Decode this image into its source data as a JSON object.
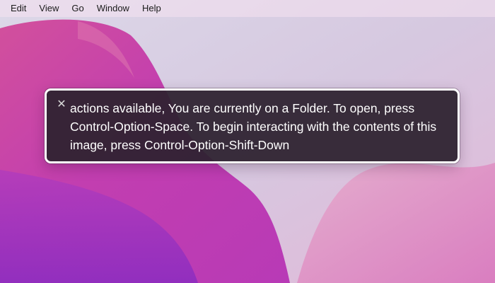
{
  "menubar": {
    "items": [
      {
        "label": "Edit"
      },
      {
        "label": "View"
      },
      {
        "label": "Go"
      },
      {
        "label": "Window"
      },
      {
        "label": "Help"
      }
    ]
  },
  "voiceover": {
    "close_icon": "close-icon",
    "close_glyph": "✕",
    "caption": "actions available, You are currently on a Folder. To open, press Control-Option-Space. To begin interacting with the contents of this image, press Control-Option-Shift-Down"
  },
  "colors": {
    "panel_background": "#2e2230",
    "panel_border": "#ffffff",
    "caption_text": "#ffffff",
    "wallpaper_magenta": "#c23eb0",
    "wallpaper_purple": "#9a34c4",
    "wallpaper_pink": "#e07ab0"
  }
}
